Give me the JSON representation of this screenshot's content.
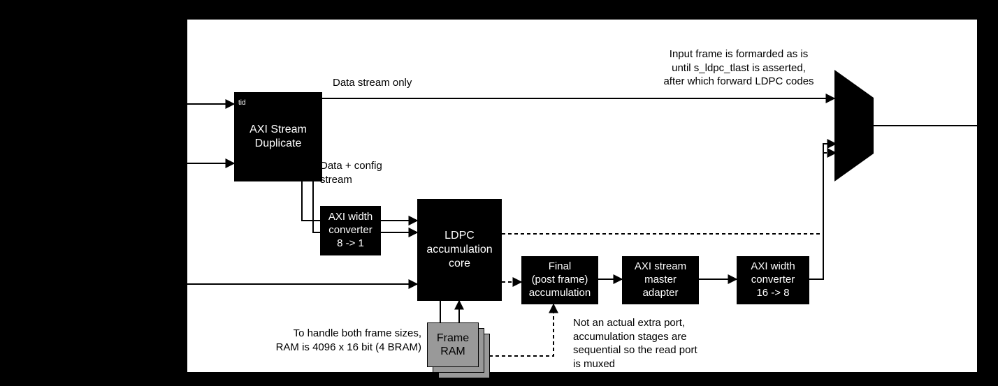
{
  "blocks": {
    "axi_stream_duplicate": {
      "label": "AXI Stream\nDuplicate"
    },
    "axi_width_8_1": {
      "label": "AXI width\nconverter\n8 -> 1"
    },
    "ldpc_core": {
      "label": "LDPC\naccumulation\ncore"
    },
    "frame_ram": {
      "label": "Frame\nRAM"
    },
    "final_accum": {
      "label": "Final\n(post frame)\naccumulation"
    },
    "axi_master_adapter": {
      "label": "AXI stream\nmaster\nadapter"
    },
    "axi_width_16_8": {
      "label": "AXI width\nconverter\n16 -> 8"
    }
  },
  "notes": {
    "tid": "tid",
    "data_stream_only": "Data stream only",
    "data_config": "Data + config\nstream",
    "ram_note": "To handle both frame sizes,\nRAM is 4096 x 16 bit (4 BRAM)",
    "mux_note": "Not an actual extra port,\naccumulation stages are\nsequential so the read port\nis muxed",
    "top_right": "Input frame is formarded as is\nuntil s_ldpc_tlast is asserted,\nafter which forward LDPC codes"
  }
}
